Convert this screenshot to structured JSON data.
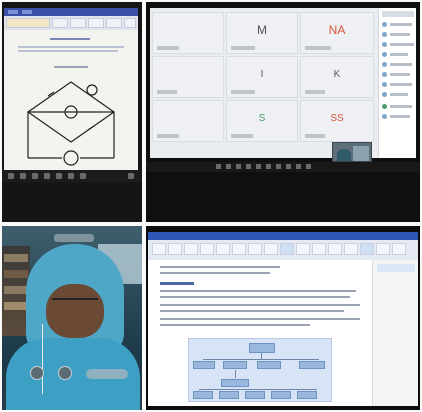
{
  "panels": {
    "top_left": {
      "description_hidden": true
    },
    "top_right": {
      "initials": [
        "M",
        "NA",
        "I",
        "K",
        "S",
        "SS"
      ]
    },
    "bottom_left": {},
    "bottom_right": {}
  },
  "colors": {
    "doc_titlebar": "#3b4fa8",
    "call_background": "#e9ecf0",
    "initials_accent": "#d9533c",
    "webcam_scarf": "#4ea7c6",
    "doc2_titlebar": "#2f57b8",
    "chart_fill": "#d7e4f5"
  }
}
